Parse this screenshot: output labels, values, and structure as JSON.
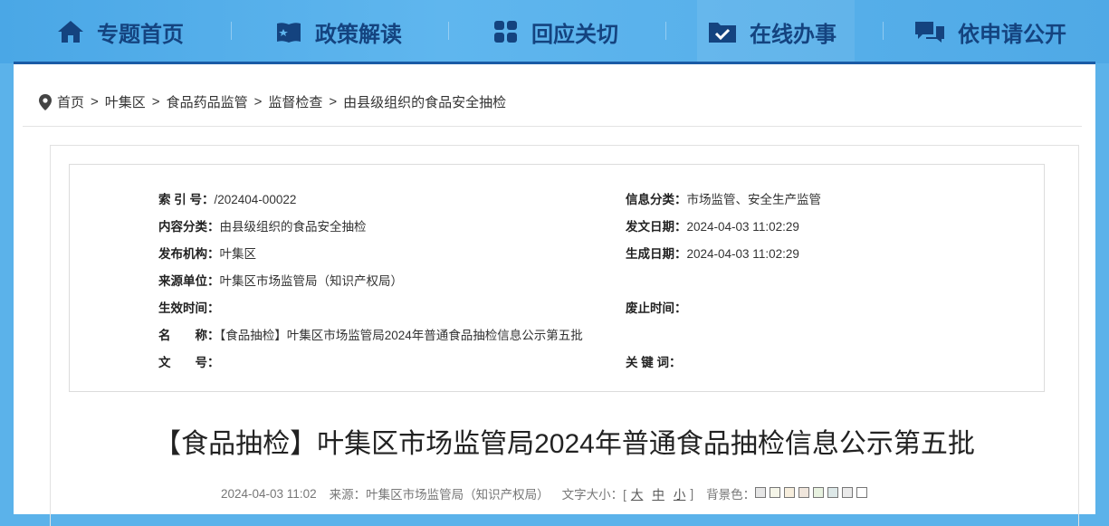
{
  "nav": {
    "items": [
      {
        "label": "专题首页",
        "icon": "home-icon"
      },
      {
        "label": "政策解读",
        "icon": "book-icon"
      },
      {
        "label": "回应关切",
        "icon": "grid-icon"
      },
      {
        "label": "在线办事",
        "icon": "folder-check-icon"
      },
      {
        "label": "依申请公开",
        "icon": "chat-bubbles-icon"
      }
    ]
  },
  "breadcrumb": {
    "items": [
      "首页",
      "叶集区",
      "食品药品监管",
      "监督检查",
      "由县级组织的食品安全抽检"
    ],
    "separator": ">"
  },
  "meta": {
    "index_label": "索 引 号：",
    "index_value": "/202404-00022",
    "info_cat_label": "信息分类：",
    "info_cat_value": "市场监管、安全生产监管",
    "content_cat_label": "内容分类：",
    "content_cat_value": "由县级组织的食品安全抽检",
    "pub_date_label": "发文日期：",
    "pub_date_value": "2024-04-03 11:02:29",
    "publisher_label": "发布机构：",
    "publisher_value": "叶集区",
    "gen_date_label": "生成日期：",
    "gen_date_value": "2024-04-03 11:02:29",
    "source_label": "来源单位：",
    "source_value": "叶集区市场监管局（知识产权局）",
    "effective_label": "生效时间：",
    "effective_value": "",
    "expire_label": "废止时间：",
    "expire_value": "",
    "name_label": "名　　称：",
    "name_value": "【食品抽检】叶集区市场监管局2024年普通食品抽检信息公示第五批",
    "docno_label": "文　　号：",
    "docno_value": "",
    "keywords_label": "关 键 词：",
    "keywords_value": ""
  },
  "article": {
    "title": "【食品抽检】叶集区市场监管局2024年普通食品抽检信息公示第五批",
    "datetime": "2024-04-03 11:02",
    "source": "来源：叶集区市场监管局（知识产权局）",
    "font_size_label": "文字大小：[",
    "font_size_options": [
      "大",
      "中",
      "小"
    ],
    "font_size_close": "]",
    "bg_label": "背景色：",
    "bg_colors": [
      "#e6e6e6",
      "#f5f5e8",
      "#f7eedd",
      "#f0e6dc",
      "#e8f2e0",
      "#dde8e8",
      "#eaeaea",
      "#ffffff"
    ]
  },
  "colors": {
    "nav_text": "#14437f",
    "accent_bar": "#1a5ba6",
    "page_bg": "#5bb2ea"
  }
}
